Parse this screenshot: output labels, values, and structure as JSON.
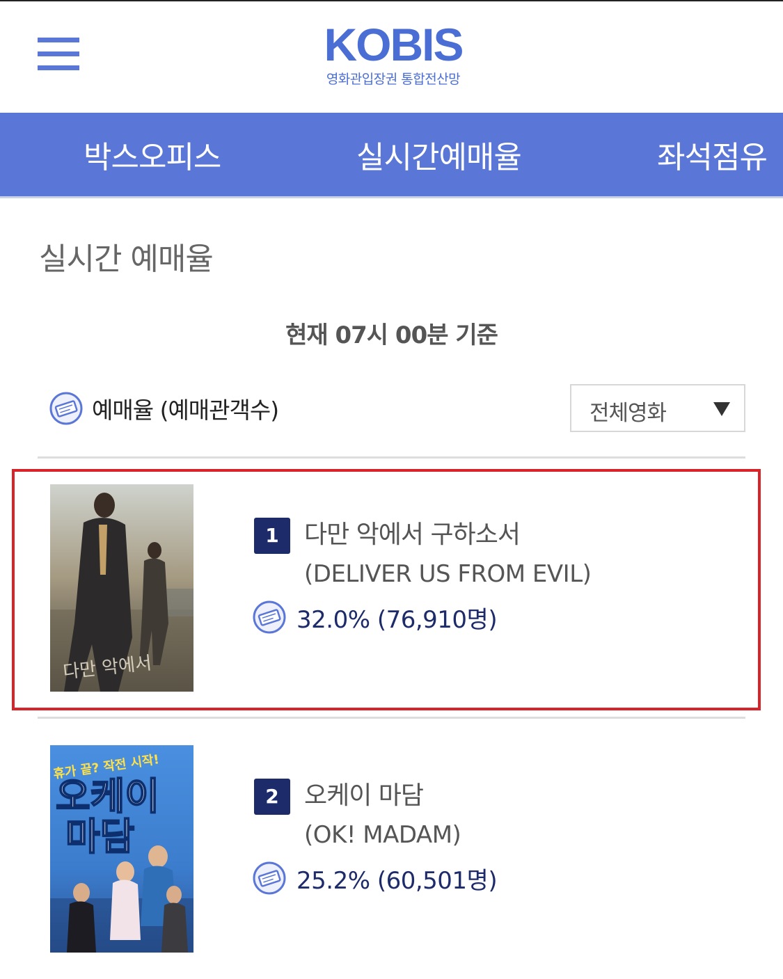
{
  "header": {
    "logo_main": "KOBIS",
    "logo_sub": "영화관입장권 통합전산망"
  },
  "nav": {
    "items": [
      {
        "label": "박스오피스"
      },
      {
        "label": "실시간예매율"
      },
      {
        "label": "좌석점유"
      }
    ]
  },
  "page": {
    "title": "실시간 예매율",
    "timestamp": "현재  07시 00분   기준"
  },
  "legend": {
    "label": "예매율 (예매관객수)",
    "icon": "ticket-icon"
  },
  "filter": {
    "selected": "전체영화"
  },
  "colors": {
    "brand": "#5a76d6",
    "rank_badge": "#1d2b6a",
    "highlight": "#d8232a"
  },
  "movies": [
    {
      "rank": "1",
      "title_ko": "다만 악에서 구하소서",
      "title_en": "(DELIVER US FROM EVIL)",
      "stat": "32.0% (76,910명)",
      "rate_percent": 32.0,
      "audience": 76910
    },
    {
      "rank": "2",
      "title_ko": "오케이 마담",
      "title_en": "(OK! MADAM)",
      "stat": "25.2% (60,501명)",
      "rate_percent": 25.2,
      "audience": 60501
    }
  ]
}
